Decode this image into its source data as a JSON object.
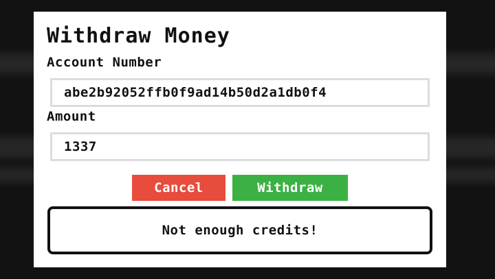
{
  "dialog": {
    "title": "Withdraw Money",
    "account_label": "Account Number",
    "account_value": "abe2b92052ffb0f9ad14b50d2a1db0f4",
    "amount_label": "Amount",
    "amount_value": "1337",
    "cancel_label": "Cancel",
    "withdraw_label": "Withdraw",
    "message": "Not enough credits!"
  },
  "colors": {
    "cancel": "#e74c3c",
    "withdraw": "#3bb143",
    "overlay": "#121212"
  }
}
